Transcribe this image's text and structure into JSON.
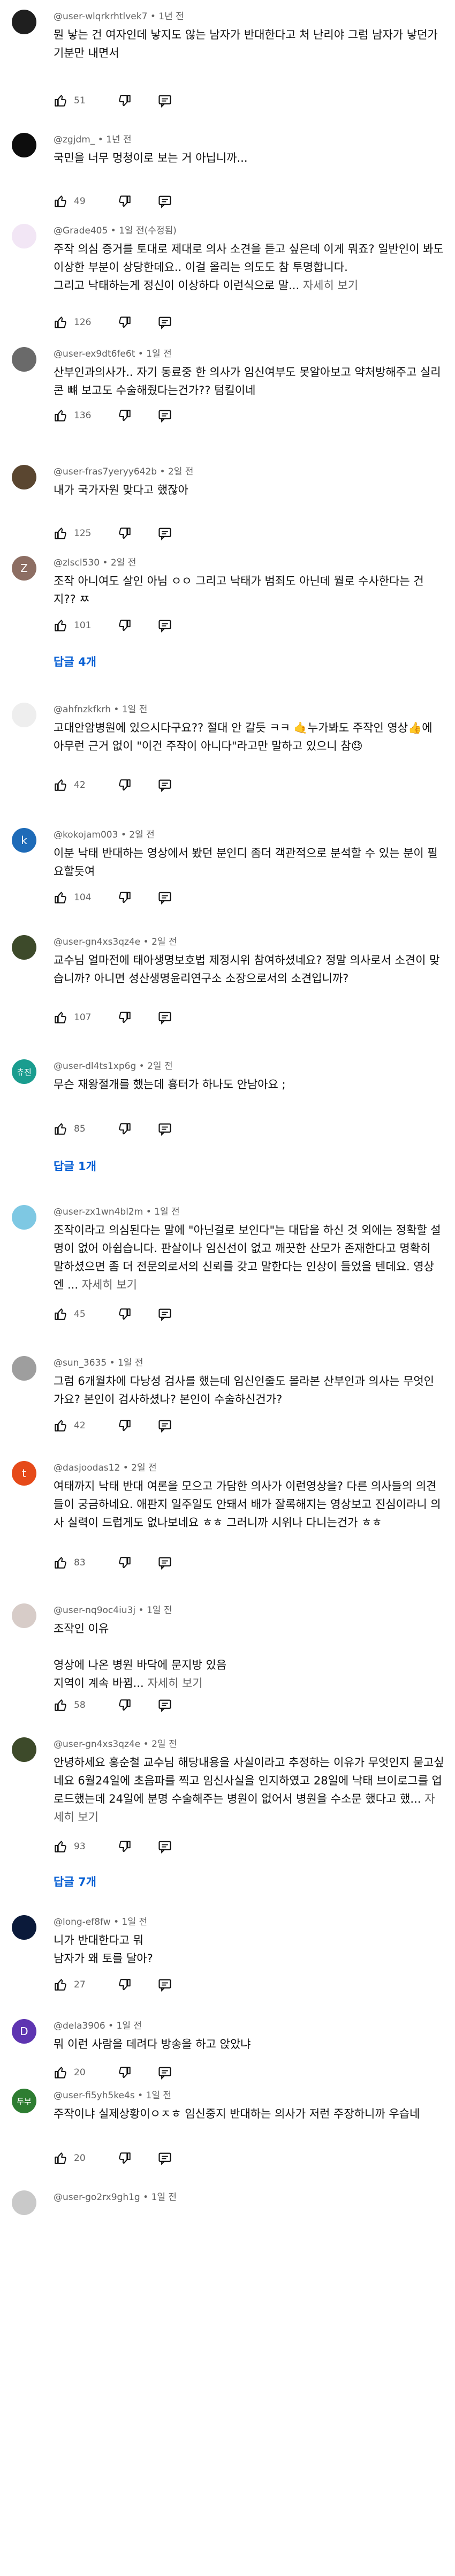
{
  "comments": [
    {
      "handle": "@user-wlqrkrhtlvek7",
      "time": "1년 전",
      "text": "뭔 낳는 건 여자인데 낳지도 않는 남자가 반대한다고 처 난리야 그럼 남자가 낳던가 기분만 내면서",
      "more": "",
      "likes": "51",
      "avatar": {
        "letter": "",
        "bg": "#1f1f1f"
      }
    },
    {
      "handle": "@zgjdm_",
      "time": "1년 전",
      "text": "국민을 너무 멍청이로 보는 거 아닙니까...",
      "more": "",
      "likes": "49",
      "avatar": {
        "letter": "",
        "bg": "#0d0d0d"
      }
    },
    {
      "handle": "@Grade405",
      "time": "1일 전(수정됨)",
      "text": "주작 의심 증거를 토대로 제대로 의사 소견을 듣고 싶은데 이게 뭐죠? 일반인이 봐도 이상한 부분이 상당한데요.. 이걸 올리는 의도도 참 투명합니다.\n그리고 낙태하는게 정신이 이상하다 이런식으로 말...",
      "more": "자세히 보기",
      "likes": "126",
      "avatar": {
        "letter": "",
        "bg": "#f2e6f5"
      }
    },
    {
      "handle": "@user-ex9dt6fe6t",
      "time": "1일 전",
      "text": "산부인과의사가.. 자기 동료중 한 의사가 임신여부도 못알아보고 약처방해주고 실리콘 뺴 보고도 수술해줬다는건가?? 텀킬이네",
      "more": "",
      "likes": "136",
      "avatar": {
        "letter": "",
        "bg": "#6a6a6a"
      }
    },
    {
      "handle": "@user-fras7yeryy642b",
      "time": "2일 전",
      "text": "내가 국가자원 맞다고 했잖아",
      "more": "",
      "likes": "125",
      "avatar": {
        "letter": "",
        "bg": "#5a4630"
      }
    },
    {
      "handle": "@zlscl530",
      "time": "2일 전",
      "text": "조작 아니여도 살인 아님 ㅇㅇ 그리고 낙태가 범죄도 아닌데 뭘로 수사한다는 건지?? ㅉ",
      "more": "",
      "likes": "101",
      "avatar": {
        "letter": "Z",
        "bg": "#8d6e63"
      },
      "replies": "답글 4개"
    },
    {
      "handle": "@ahfnzkfkrh",
      "time": "1일 전",
      "text": "고대안암병원에 있으시다구요?? 절대 안 갈듯 ㅋㅋ 🤙누가봐도 주작인 영상👍에 아무런 근거 없이 \"이건 주작이 아니다\"라고만 말하고 있으니 참😓",
      "more": "",
      "likes": "42",
      "avatar": {
        "letter": "",
        "bg": "#eeeeee"
      }
    },
    {
      "handle": "@kokojam003",
      "time": "2일 전",
      "text": "이분 낙태 반대하는 영상에서 봤던 분인디 좀더 객관적으로 분석할 수 있는 분이 필요할듯여",
      "more": "",
      "likes": "104",
      "avatar": {
        "letter": "k",
        "bg": "#1e6bb8"
      }
    },
    {
      "handle": "@user-gn4xs3qz4e",
      "time": "2일 전",
      "text": "교수님 얼마전에 태아생명보호법 제정시위 참여하셨네요? 정말 의사로서 소견이 맞습니까? 아니면 성산생명윤리연구소 소장으로서의 소견입니까?",
      "more": "",
      "likes": "107",
      "avatar": {
        "letter": "",
        "bg": "#3d4a2a"
      }
    },
    {
      "handle": "@user-dl4ts1xp6g",
      "time": "2일 전",
      "text": "무슨 재왕절개를 했는데 흉터가 하나도 안남아요 ;",
      "more": "",
      "likes": "85",
      "avatar": {
        "letter": "츄진",
        "bg": "#1a9d8f",
        "small": true
      },
      "replies": "답글 1개"
    },
    {
      "handle": "@user-zx1wn4bl2m",
      "time": "1일 전",
      "text": "조작이라고 의심된다는 말에 \"아닌걸로 보인다\"는 대답을 하신 것 외에는 정확할 설명이 없어 아쉽습니다. 판살이나 임신선이 없고 깨끗한 산모가 존재한다고 명확히 말하셨으면 좀 더 전문의로서의 신뢰를 갖고 말한다는 인상이 들었을 텐데요. 영상엔 ...",
      "more": "자세히 보기",
      "likes": "45",
      "avatar": {
        "letter": "",
        "bg": "#7ec8e3"
      }
    },
    {
      "handle": "@sun_3635",
      "time": "1일 전",
      "text": "그럼 6개월차에 다낭성 검사를 했는데 임신인줄도 몰라본 산부인과 의사는 무엇인가요? 본인이 검사하셨나? 본인이 수술하신건가?",
      "more": "",
      "likes": "42",
      "avatar": {
        "letter": "",
        "bg": "#9e9e9e"
      }
    },
    {
      "handle": "@dasjoodas12",
      "time": "2일 전",
      "text": "여태까지 낙태 반대 여론을 모으고 가담한 의사가 이런영상을? 다른 의사들의 의견들이 궁금하네요. 애판지 일주일도 안돼서 배가 잘록해지는 영상보고 진심이라니 의사 실력이 드럽게도 없나보네요 ㅎㅎ 그러니까 시위나 다니는건가 ㅎㅎ",
      "more": "",
      "likes": "83",
      "avatar": {
        "letter": "t",
        "bg": "#e64a19"
      }
    },
    {
      "handle": "@user-nq9oc4iu3j",
      "time": "1일 전",
      "text": "조작인 이유\n\n영상에 나온 병원 바닥에 문지방 있음\n지역이 계속 바뀜...",
      "more": "자세히 보기",
      "likes": "58",
      "avatar": {
        "letter": "",
        "bg": "#d7ccc8"
      }
    },
    {
      "handle": "@user-gn4xs3qz4e",
      "time": "2일 전",
      "text": "안녕하세요 홍순철 교수님 해당내용을 사실이라고 추정하는 이유가 무엇인지 묻고싶네요 6월24일에 초음파를 찍고 임신사실을 인지하였고 28일에 낙태 브이로그를 업로드했는데 24일에 분명 수술해주는 병원이 없어서 병원을 수소문 했다고 했...",
      "more": "자세히 보기",
      "likes": "93",
      "avatar": {
        "letter": "",
        "bg": "#3d4a2a"
      },
      "replies": "답글 7개"
    },
    {
      "handle": "@long-ef8fw",
      "time": "1일 전",
      "text": "니가 반대한다고 뭐\n남자가 왜 토를 달아?",
      "more": "",
      "likes": "27",
      "avatar": {
        "letter": "",
        "bg": "#0b1a3a"
      }
    },
    {
      "handle": "@dela3906",
      "time": "1일 전",
      "text": "뭐 이런 사람을 데려다 방송을 하고 앉았냐",
      "more": "",
      "likes": "20",
      "avatar": {
        "letter": "D",
        "bg": "#5e35b1"
      }
    },
    {
      "handle": "@user-fi5yh5ke4s",
      "time": "1일 전",
      "text": "주작이냐 실제상황이ㅇㅈㅎ 임신중지 반대하는 의사가 저런 주장하니까 우습네",
      "more": "",
      "likes": "20",
      "avatar": {
        "letter": "두부",
        "bg": "#2e7d32",
        "small": true
      }
    },
    {
      "handle": "@user-go2rx9gh1g",
      "time": "1일 전",
      "text": "",
      "more": "",
      "likes": "",
      "avatar": {
        "letter": "",
        "bg": "#c9c9c9"
      }
    }
  ]
}
